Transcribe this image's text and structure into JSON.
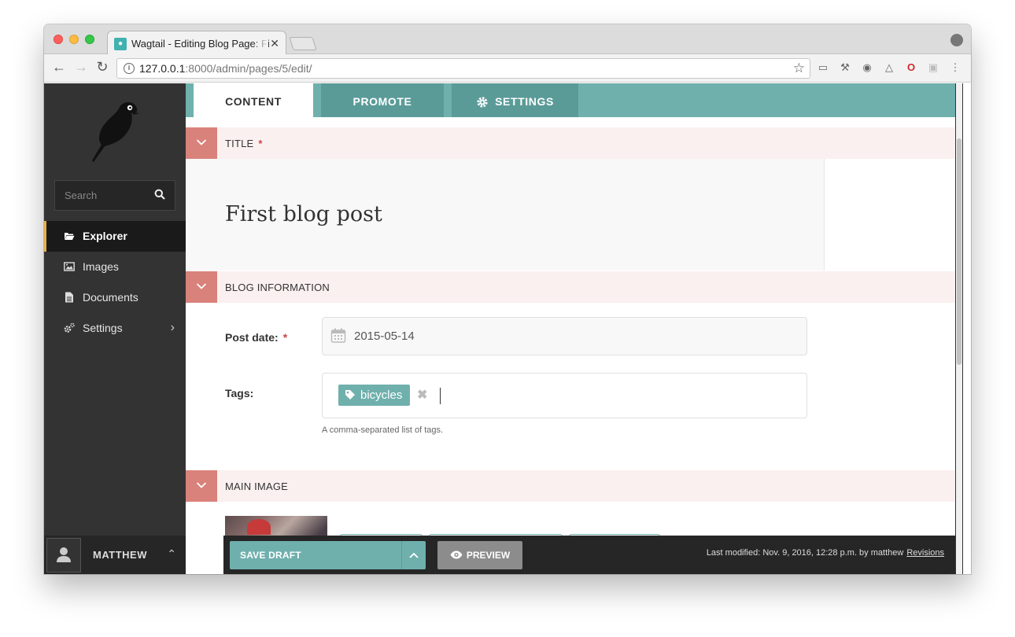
{
  "browser": {
    "tab_title": "Wagtail - Editing Blog Page: First blog post",
    "url_host": "127.0.0.1",
    "url_rest": ":8000/admin/pages/5/edit/"
  },
  "sidebar": {
    "search_placeholder": "Search",
    "items": [
      {
        "label": "Explorer",
        "icon": "folder-open-icon",
        "active": true
      },
      {
        "label": "Images",
        "icon": "image-icon"
      },
      {
        "label": "Documents",
        "icon": "document-icon"
      },
      {
        "label": "Settings",
        "icon": "cogs-icon"
      }
    ],
    "account_name": "MATTHEW"
  },
  "tabs": [
    {
      "label": "CONTENT"
    },
    {
      "label": "PROMOTE"
    },
    {
      "label": "SETTINGS"
    }
  ],
  "sections": {
    "title": {
      "label": "TITLE",
      "required_mark": "*",
      "value": "First blog post"
    },
    "blog_information": {
      "label": "BLOG INFORMATION"
    },
    "main_image": {
      "label": "MAIN IMAGE"
    }
  },
  "fields": {
    "post_date": {
      "label": "Post date:",
      "required_mark": "*",
      "value": "2015-05-14"
    },
    "tags": {
      "label": "Tags:",
      "chips": [
        "bicycles"
      ],
      "remove_glyph": "✖",
      "help": "A comma-separated list of tags."
    }
  },
  "actions": {
    "save_draft": "SAVE DRAFT",
    "preview": "PREVIEW",
    "last_modified": "Last modified: Nov. 9, 2016, 12:28 p.m. by matthew",
    "revisions": "Revisions"
  },
  "colors": {
    "teal": "#6fb0ad",
    "sidebar": "#333333",
    "section_toggle": "#d9817b",
    "section_bg": "#faf0ef"
  }
}
